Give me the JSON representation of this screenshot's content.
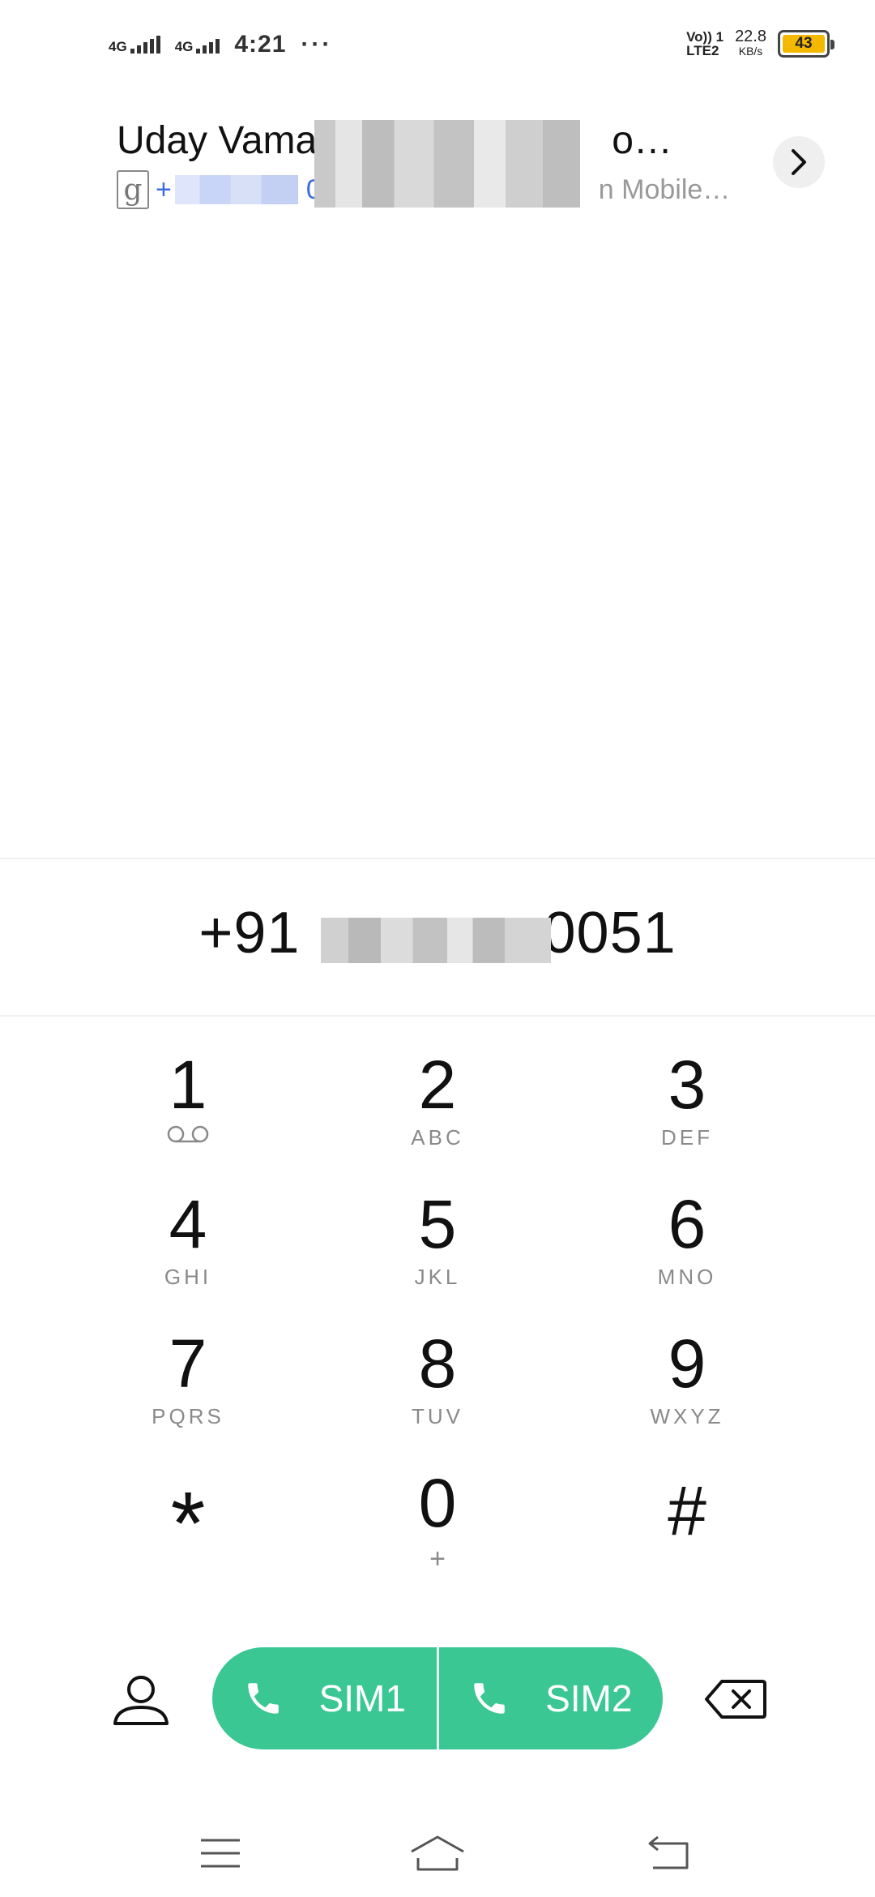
{
  "status_bar": {
    "sim1_network": "4G",
    "sim2_network": "4G",
    "time": "4:21",
    "more": "···",
    "volte_line1": "Vo)) 1",
    "volte_line2": "LTE2",
    "speed_value": "22.8",
    "speed_unit": "KB/s",
    "battery_level": "43",
    "battery_color": "#f5b800"
  },
  "suggestion": {
    "name": "Uday Vama",
    "name_end": "o…",
    "number_start": "+",
    "number_digit": "0",
    "carrier": "n Mobile…",
    "open_icon": "chevron-right-icon"
  },
  "dialer": {
    "number_prefix": "+91",
    "number_suffix": "0051"
  },
  "keypad": [
    {
      "digit": "1",
      "letters": "",
      "icon": "voicemail-icon"
    },
    {
      "digit": "2",
      "letters": "ABC"
    },
    {
      "digit": "3",
      "letters": "DEF"
    },
    {
      "digit": "4",
      "letters": "GHI"
    },
    {
      "digit": "5",
      "letters": "JKL"
    },
    {
      "digit": "6",
      "letters": "MNO"
    },
    {
      "digit": "7",
      "letters": "PQRS"
    },
    {
      "digit": "8",
      "letters": "TUV"
    },
    {
      "digit": "9",
      "letters": "WXYZ"
    },
    {
      "digit": "*",
      "letters": ""
    },
    {
      "digit": "0",
      "letters": "+"
    },
    {
      "digit": "#",
      "letters": ""
    }
  ],
  "actions": {
    "contacts_icon": "person-icon",
    "sim1_label": "SIM1",
    "sim2_label": "SIM2",
    "backspace_icon": "backspace-icon",
    "call_color": "#3ac794"
  },
  "navbar": {
    "menu_icon": "menu-icon",
    "home_icon": "home-icon",
    "back_icon": "back-icon"
  }
}
